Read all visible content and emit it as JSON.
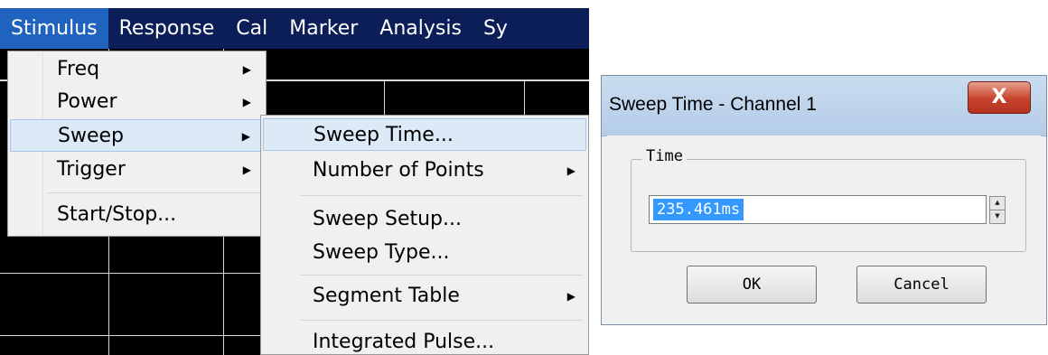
{
  "menubar": {
    "items": [
      "Stimulus",
      "Response",
      "Cal",
      "Marker",
      "Analysis",
      "Sy"
    ],
    "active": "Stimulus"
  },
  "stimulus_menu": {
    "items": [
      {
        "label": "Freq",
        "submenu": true
      },
      {
        "label": "Power",
        "submenu": true
      },
      {
        "label": "Sweep",
        "submenu": true,
        "highlighted": true
      },
      {
        "label": "Trigger",
        "submenu": true
      },
      {
        "label": "Start/Stop...",
        "submenu": false
      }
    ]
  },
  "sweep_submenu": {
    "items": [
      {
        "label": "Sweep Time...",
        "submenu": false,
        "highlighted": true
      },
      {
        "label": "Number of Points",
        "submenu": true
      },
      {
        "label": "Sweep Setup...",
        "submenu": false
      },
      {
        "label": "Sweep Type...",
        "submenu": false
      },
      {
        "label": "Segment Table",
        "submenu": true
      },
      {
        "label": "Integrated Pulse...",
        "submenu": false
      }
    ]
  },
  "dialog": {
    "title": "Sweep Time - Channel 1",
    "close_label": "X",
    "group_label": "Time",
    "time_value": "235.461ms",
    "ok_label": "OK",
    "cancel_label": "Cancel"
  },
  "colors": {
    "menubar_bg": "#0b1e57",
    "menubar_active": "#1f63bf",
    "selection": "#3399ff",
    "close_button": "#c5422b"
  },
  "icons": {
    "submenu_arrow": "chevron-right-icon",
    "spin_up": "spin-up-icon",
    "spin_down": "spin-down-icon",
    "close": "close-icon"
  }
}
